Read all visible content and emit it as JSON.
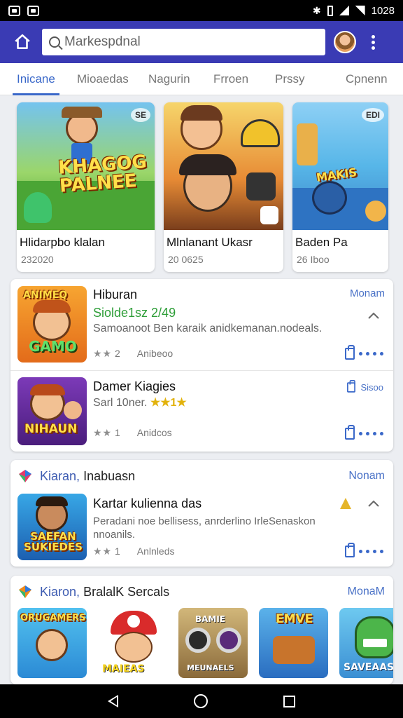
{
  "status_bar": {
    "time": "1028"
  },
  "app_bar": {
    "search_placeholder": "Markespdnal"
  },
  "tabs": [
    {
      "label": "Inicane",
      "active": true
    },
    {
      "label": "Mioaedas"
    },
    {
      "label": "Nagurin"
    },
    {
      "label": "Frroen"
    },
    {
      "label": "Prssy"
    },
    {
      "label": "Cpnenn"
    }
  ],
  "featured": [
    {
      "title": "Hlidarpbo klalan",
      "subtitle": "232020",
      "art_text": "KHAGOG PALNEE",
      "badge": "SE"
    },
    {
      "title": "Mlnlanant Ukasr",
      "subtitle": "20 0625",
      "art_text": "",
      "badge": ""
    },
    {
      "title": "Baden Pa",
      "subtitle": "26 Iboo",
      "art_text": "MAKIS",
      "badge": "EDI"
    }
  ],
  "list1": {
    "items": [
      {
        "name": "Hiburan",
        "subtitle": "Siolde1sz 2/49",
        "description": "Samoanoot Ben karaik anidkemanan.nodeals.",
        "stars": "★★",
        "rating": "2",
        "meta": "Anibeoo",
        "link": "Monam",
        "thumb_text": "GAMO",
        "thumb_top": "ANIMEQ"
      },
      {
        "name": "Damer Kiagies",
        "subtitle": "Sarl 10ner.",
        "stars_gold": "★★1★",
        "stars": "★★",
        "rating": "1",
        "meta": "Anidcos",
        "link": "Sisoo",
        "thumb_text": "NIHAUN"
      }
    ]
  },
  "section2": {
    "brand": "Kiaran,",
    "title": "Inabuasn",
    "link": "Nonam",
    "item": {
      "name": "Kartar kulienna das",
      "description": "Peradani noe bellisess, anrderlino IrleSenaskon nnoanils.",
      "stars": "★★",
      "rating": "1",
      "meta": "Anlnleds",
      "thumb_text": "SAEFAN SUKIEDES"
    }
  },
  "section3": {
    "brand": "Kiaron,",
    "title": "BralalK Sercals",
    "link": "MonaM",
    "thumbs": [
      {
        "label": "ORUGAMERS"
      },
      {
        "label": "MAIEAS"
      },
      {
        "label": "MEUNAELS"
      },
      {
        "label": "EMVE"
      },
      {
        "label": "SAVEAAS"
      }
    ]
  },
  "colors": {
    "app_bar": "#3a3bb4",
    "accent": "#3a68c9",
    "green": "#2e9e38"
  }
}
